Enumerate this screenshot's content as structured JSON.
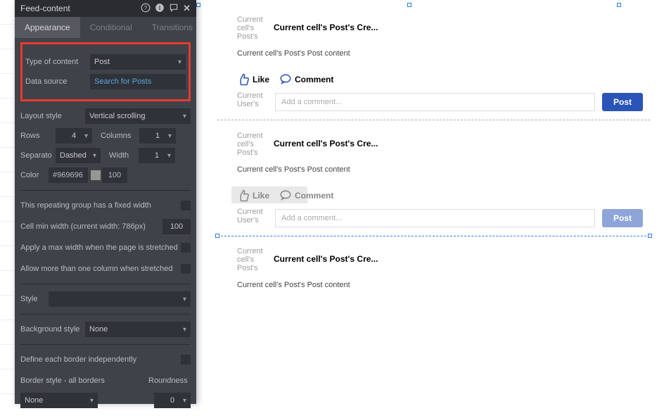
{
  "panel": {
    "title": "Feed-content",
    "tabs": {
      "appearance": "Appearance",
      "conditional": "Conditional",
      "transitions": "Transitions"
    },
    "type_of_content": {
      "label": "Type of content",
      "value": "Post"
    },
    "data_source": {
      "label": "Data source",
      "value": "Search for Posts"
    },
    "layout_style": {
      "label": "Layout style",
      "value": "Vertical scrolling"
    },
    "rows": {
      "label": "Rows",
      "value": "4"
    },
    "columns": {
      "label": "Columns",
      "value": "1"
    },
    "separator": {
      "label": "Separato",
      "value": "Dashed"
    },
    "width": {
      "label": "Width",
      "value": "1"
    },
    "color": {
      "label": "Color",
      "hex": "#969696",
      "alpha": "100"
    },
    "fixed_width": "This repeating group has a fixed width",
    "cell_min_width": {
      "label": "Cell min width (current width: 786px)",
      "value": "100"
    },
    "apply_max_width": "Apply a max width when the page is stretched",
    "allow_more_col": "Allow more than one column when stretched",
    "style_label": "Style",
    "background_style": {
      "label": "Background style",
      "value": "None"
    },
    "define_border": "Define each border independently",
    "border_style": {
      "label": "Border style - all borders",
      "value": "None"
    },
    "roundness": {
      "label": "Roundness",
      "value": "0"
    }
  },
  "cell": {
    "avatar_text": "Current cell's Post's",
    "post_title": "Current cell's Post's Cre...",
    "post_content": "Current cell's Post's Post content",
    "like": "Like",
    "comment": "Comment",
    "user_text": "Current User's",
    "comment_placeholder": "Add a comment...",
    "post_btn": "Post"
  }
}
